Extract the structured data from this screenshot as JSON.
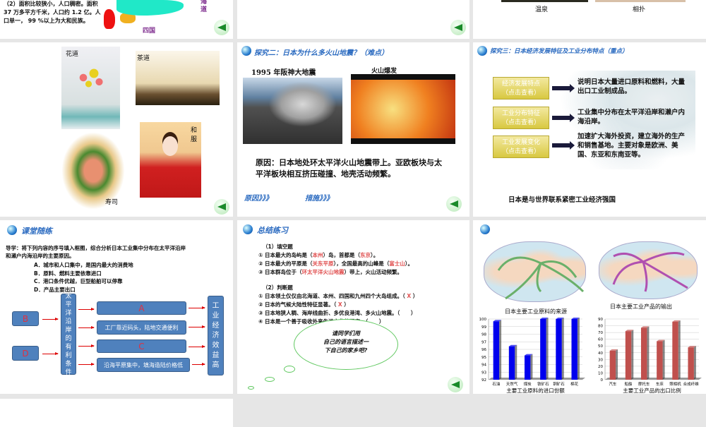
{
  "slide1": {
    "text": "（2）面积比较狭小，人口稠密。面积 37 万多平方千米，人口约 1.2 亿。人口单一，  99 %以上为大和民族。",
    "label_hokkaido": "海道",
    "label_shikoku": "四国"
  },
  "slide3": {
    "caption1": "温泉",
    "caption2": "相扑"
  },
  "slide4": {
    "labels": [
      "花道",
      "茶道",
      "和服",
      "寿司"
    ]
  },
  "slide5": {
    "title": "探究二：日本为什么多火山地震？（难点）",
    "img1_caption": "1995 年阪神大地震",
    "img2_caption": "火山爆发",
    "body": "原因：日本地处环太平洋火山地震带上。亚欧板块与太平洋板块相互挤压碰撞、地壳活动频繁。",
    "link1": "原因》》》",
    "link2": "措施》》》"
  },
  "slide6": {
    "title": "探究三：日本经济发展特征及工业分布特点（重点）",
    "items": [
      {
        "box": "经济发展特点",
        "sub": "（点击查看）",
        "text": "说明日本大量进口原料和燃料，大量出口工业制成品。"
      },
      {
        "box": "工业分布特征",
        "sub": "（点击查看）",
        "text": "工业集中分布在太平洋沿岸和濑户内海沿岸。"
      },
      {
        "box": "工业发展变化",
        "sub": "（点击查看）",
        "text": "加速扩大海外投资，建立海外的生产和销售基地。主要对象是欧洲、美国、东亚和东南亚等。"
      }
    ],
    "footer": "日本是与世界联系紧密工业经济强国"
  },
  "slide7": {
    "title": "课堂随练",
    "intro": "导学：将下列内容的序号填入框图，综合分析日本工业集中分布在太平洋沿岸和濑户内海沿岸的主要原因。",
    "options": [
      "A．城市和人口集中，是国内最大的消费地",
      "B．原料、燃料主要依靠进口",
      "C．港口条件优越，巨型船舶可以停靠",
      "D．产品主要出口"
    ],
    "left_boxes": [
      "B",
      "D"
    ],
    "center": "太平洋沿岸的有利条件",
    "right_rows": [
      "A",
      "工厂靠近码头，陆地交通便利",
      "C",
      "沿海平原集中，填海造陆价格低"
    ],
    "result": "工业经济效益高"
  },
  "slide8": {
    "title": "总结练习",
    "fill_heading": "（1）填空题",
    "fill": [
      {
        "a": "① 日本最大的岛屿是（",
        "b": "本州",
        "c": "）岛，首都是（",
        "d": "东京",
        "e": "）。"
      },
      {
        "a": "② 日本最大的平原是（",
        "b": "关东平原",
        "c": "），全国最高的山峰是（",
        "d": "富士山",
        "e": "）。"
      },
      {
        "a": "③ 日本群岛位于（",
        "b": "环太平洋火山地震",
        "c": "）带上，火山活动频繁。",
        "d": "",
        "e": ""
      }
    ],
    "judge_heading": "（2）判断题",
    "judge": [
      {
        "q": "① 日本领土仅仅由北海道、本州、四国和九州四个大岛组成。（",
        "ans": "X",
        "end": "）"
      },
      {
        "q": "② 日本的气候大陆性特征显著。（",
        "ans": "X",
        "end": "）"
      },
      {
        "q": "③ 日本地狭人稠、海岸线曲折、多优良港湾、多火山地震。（",
        "ans": "",
        "end": "）"
      },
      {
        "q": "④ 日本是一个善于吸收外来先进文化的国家。（",
        "ans": "",
        "end": "）"
      }
    ],
    "cloud": [
      "请同学们用",
      "自己的语言描述一",
      "下自己的家乡吧?"
    ]
  },
  "slide9": {
    "map1_caption": "日本主要工业原料的来源",
    "map2_caption": "日本主要工业产品的输出"
  },
  "chart_data": [
    {
      "type": "bar",
      "title": "",
      "xlabel": "主要工业原料的进口份额",
      "ylabel": "",
      "categories": [
        "石油",
        "天然气",
        "煤炭",
        "铁矿石",
        "铜矿石",
        "棉花"
      ],
      "values": [
        99.7,
        96.4,
        95.2,
        100,
        100,
        100
      ],
      "ylim": [
        92,
        100
      ],
      "yticks": [
        92,
        93,
        94,
        95,
        96,
        97,
        98,
        99,
        100
      ],
      "color": "#0000ee",
      "grid": true
    },
    {
      "type": "bar",
      "title": "",
      "xlabel": "主要工业产品的出口比例",
      "ylabel": "",
      "categories": [
        "汽车",
        "船舶",
        "摩托车",
        "车床",
        "照相机",
        "合成纤维"
      ],
      "values": [
        43,
        72,
        77,
        57,
        86,
        48
      ],
      "ylim": [
        0,
        90
      ],
      "yticks": [
        0,
        10,
        20,
        30,
        40,
        50,
        60,
        70,
        80,
        90
      ],
      "color": "#c0504d",
      "grid": true
    }
  ]
}
